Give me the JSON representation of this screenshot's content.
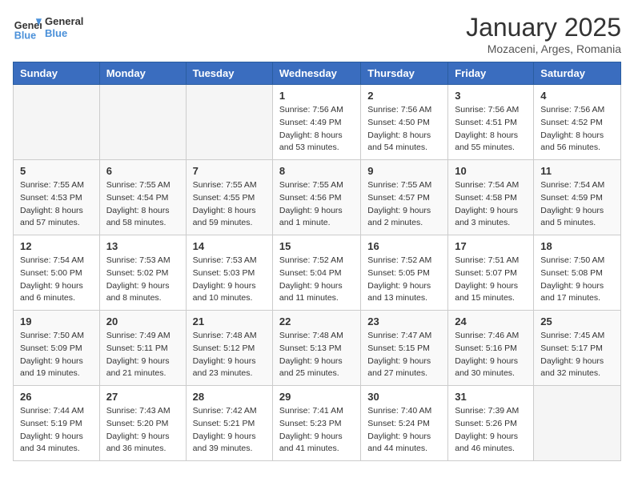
{
  "header": {
    "logo_general": "General",
    "logo_blue": "Blue",
    "month_title": "January 2025",
    "subtitle": "Mozaceni, Arges, Romania"
  },
  "days_of_week": [
    "Sunday",
    "Monday",
    "Tuesday",
    "Wednesday",
    "Thursday",
    "Friday",
    "Saturday"
  ],
  "weeks": [
    [
      {
        "day": "",
        "info": ""
      },
      {
        "day": "",
        "info": ""
      },
      {
        "day": "",
        "info": ""
      },
      {
        "day": "1",
        "info": "Sunrise: 7:56 AM\nSunset: 4:49 PM\nDaylight: 8 hours and 53 minutes."
      },
      {
        "day": "2",
        "info": "Sunrise: 7:56 AM\nSunset: 4:50 PM\nDaylight: 8 hours and 54 minutes."
      },
      {
        "day": "3",
        "info": "Sunrise: 7:56 AM\nSunset: 4:51 PM\nDaylight: 8 hours and 55 minutes."
      },
      {
        "day": "4",
        "info": "Sunrise: 7:56 AM\nSunset: 4:52 PM\nDaylight: 8 hours and 56 minutes."
      }
    ],
    [
      {
        "day": "5",
        "info": "Sunrise: 7:55 AM\nSunset: 4:53 PM\nDaylight: 8 hours and 57 minutes."
      },
      {
        "day": "6",
        "info": "Sunrise: 7:55 AM\nSunset: 4:54 PM\nDaylight: 8 hours and 58 minutes."
      },
      {
        "day": "7",
        "info": "Sunrise: 7:55 AM\nSunset: 4:55 PM\nDaylight: 8 hours and 59 minutes."
      },
      {
        "day": "8",
        "info": "Sunrise: 7:55 AM\nSunset: 4:56 PM\nDaylight: 9 hours and 1 minute."
      },
      {
        "day": "9",
        "info": "Sunrise: 7:55 AM\nSunset: 4:57 PM\nDaylight: 9 hours and 2 minutes."
      },
      {
        "day": "10",
        "info": "Sunrise: 7:54 AM\nSunset: 4:58 PM\nDaylight: 9 hours and 3 minutes."
      },
      {
        "day": "11",
        "info": "Sunrise: 7:54 AM\nSunset: 4:59 PM\nDaylight: 9 hours and 5 minutes."
      }
    ],
    [
      {
        "day": "12",
        "info": "Sunrise: 7:54 AM\nSunset: 5:00 PM\nDaylight: 9 hours and 6 minutes."
      },
      {
        "day": "13",
        "info": "Sunrise: 7:53 AM\nSunset: 5:02 PM\nDaylight: 9 hours and 8 minutes."
      },
      {
        "day": "14",
        "info": "Sunrise: 7:53 AM\nSunset: 5:03 PM\nDaylight: 9 hours and 10 minutes."
      },
      {
        "day": "15",
        "info": "Sunrise: 7:52 AM\nSunset: 5:04 PM\nDaylight: 9 hours and 11 minutes."
      },
      {
        "day": "16",
        "info": "Sunrise: 7:52 AM\nSunset: 5:05 PM\nDaylight: 9 hours and 13 minutes."
      },
      {
        "day": "17",
        "info": "Sunrise: 7:51 AM\nSunset: 5:07 PM\nDaylight: 9 hours and 15 minutes."
      },
      {
        "day": "18",
        "info": "Sunrise: 7:50 AM\nSunset: 5:08 PM\nDaylight: 9 hours and 17 minutes."
      }
    ],
    [
      {
        "day": "19",
        "info": "Sunrise: 7:50 AM\nSunset: 5:09 PM\nDaylight: 9 hours and 19 minutes."
      },
      {
        "day": "20",
        "info": "Sunrise: 7:49 AM\nSunset: 5:11 PM\nDaylight: 9 hours and 21 minutes."
      },
      {
        "day": "21",
        "info": "Sunrise: 7:48 AM\nSunset: 5:12 PM\nDaylight: 9 hours and 23 minutes."
      },
      {
        "day": "22",
        "info": "Sunrise: 7:48 AM\nSunset: 5:13 PM\nDaylight: 9 hours and 25 minutes."
      },
      {
        "day": "23",
        "info": "Sunrise: 7:47 AM\nSunset: 5:15 PM\nDaylight: 9 hours and 27 minutes."
      },
      {
        "day": "24",
        "info": "Sunrise: 7:46 AM\nSunset: 5:16 PM\nDaylight: 9 hours and 30 minutes."
      },
      {
        "day": "25",
        "info": "Sunrise: 7:45 AM\nSunset: 5:17 PM\nDaylight: 9 hours and 32 minutes."
      }
    ],
    [
      {
        "day": "26",
        "info": "Sunrise: 7:44 AM\nSunset: 5:19 PM\nDaylight: 9 hours and 34 minutes."
      },
      {
        "day": "27",
        "info": "Sunrise: 7:43 AM\nSunset: 5:20 PM\nDaylight: 9 hours and 36 minutes."
      },
      {
        "day": "28",
        "info": "Sunrise: 7:42 AM\nSunset: 5:21 PM\nDaylight: 9 hours and 39 minutes."
      },
      {
        "day": "29",
        "info": "Sunrise: 7:41 AM\nSunset: 5:23 PM\nDaylight: 9 hours and 41 minutes."
      },
      {
        "day": "30",
        "info": "Sunrise: 7:40 AM\nSunset: 5:24 PM\nDaylight: 9 hours and 44 minutes."
      },
      {
        "day": "31",
        "info": "Sunrise: 7:39 AM\nSunset: 5:26 PM\nDaylight: 9 hours and 46 minutes."
      },
      {
        "day": "",
        "info": ""
      }
    ]
  ]
}
